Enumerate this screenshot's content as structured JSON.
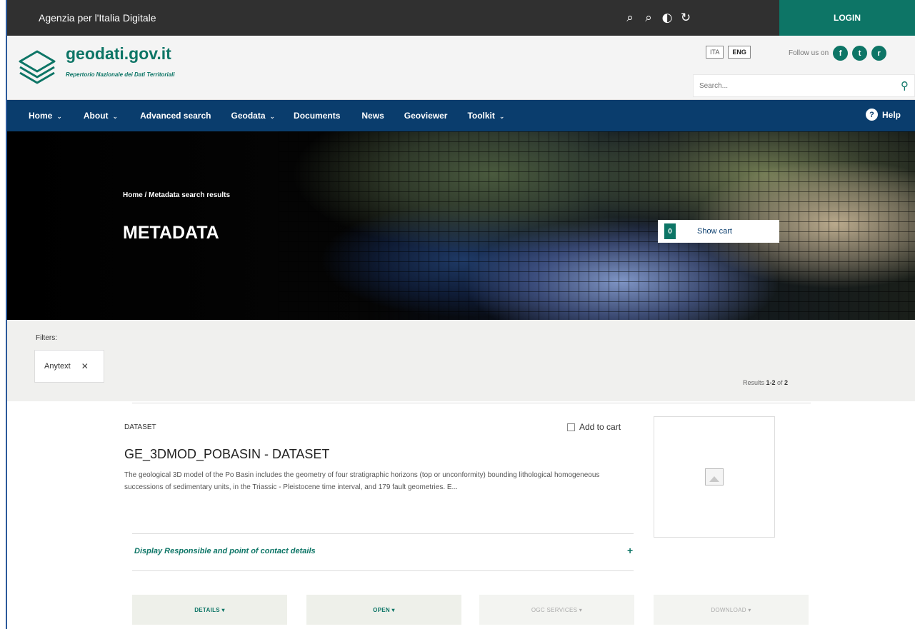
{
  "topbar": {
    "agency": "Agenzia per l'Italia Digitale",
    "tools": [
      "⌕",
      "⌕",
      "◐",
      "↻"
    ],
    "login": "LOGIN"
  },
  "header": {
    "title": "geodati.gov.it",
    "subtitle": "Repertorio Nazionale dei Dati Territoriali",
    "languages": [
      "ITA",
      "ENG"
    ],
    "follow": "Follow us on",
    "search_placeholder": "Search..."
  },
  "nav": {
    "items": [
      {
        "label": "Home",
        "dropdown": true
      },
      {
        "label": "About",
        "dropdown": true
      },
      {
        "label": "Advanced search",
        "dropdown": false
      },
      {
        "label": "Geodata",
        "dropdown": true
      },
      {
        "label": "Documents",
        "dropdown": false
      },
      {
        "label": "News",
        "dropdown": false
      },
      {
        "label": "Geoviewer",
        "dropdown": false
      },
      {
        "label": "Toolkit",
        "dropdown": true
      }
    ],
    "help": "Help"
  },
  "hero": {
    "breadcrumb": "Home /  Metadata search results",
    "title": "METADATA",
    "cart_count": "0",
    "cart_label": "Show cart"
  },
  "filters": {
    "label": "Filters:",
    "chips": [
      "Anytext"
    ]
  },
  "results": {
    "prefix": "Results ",
    "range": "1-2",
    "of": " of ",
    "total": "2"
  },
  "card": {
    "type": "DATASET",
    "add_to_cart": "Add to cart",
    "title": "GE_3DMOD_POBASIN - DATASET",
    "description": "The geological 3D model of the Po Basin includes the geometry of four stratigraphic horizons (top or unconformity) bounding lithological homogeneous successions of sedimentary units, in the Triassic - Pleistocene time interval, and 179 fault geometries. E...",
    "contact": "Display Responsible and point of contact details",
    "buttons": [
      {
        "label": "DETAILS ▾",
        "enabled": true
      },
      {
        "label": "OPEN ▾",
        "enabled": true
      },
      {
        "label": "OGC SERVICES ▾",
        "enabled": false
      },
      {
        "label": "DOWNLOAD ▾",
        "enabled": false
      }
    ]
  },
  "colors": {
    "brand_green": "#0d7566",
    "nav_blue": "#0a3d6d",
    "topbar_dark": "#303030"
  }
}
